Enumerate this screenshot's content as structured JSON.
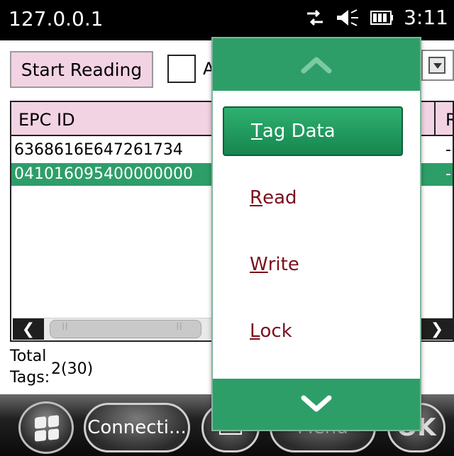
{
  "status_bar": {
    "title": "127.0.0.1",
    "time": "3:11",
    "icons": [
      "connectivity-icon",
      "speaker-icon",
      "battery-icon"
    ]
  },
  "toolbar": {
    "start_button": "Start Reading",
    "checkbox_label": "A"
  },
  "grid": {
    "columns": [
      "EPC ID",
      "R"
    ],
    "rows": [
      {
        "epc": "6368616E647261734",
        "r": "-"
      },
      {
        "epc": "041016095400000000",
        "r": "-"
      }
    ]
  },
  "totals": {
    "label_line1": "Total",
    "label_line2": "Tags:",
    "value": "2(30)"
  },
  "popup_menu": {
    "items": [
      {
        "access": "T",
        "rest": "ag Data",
        "selected": true
      },
      {
        "access": "R",
        "rest": "ead",
        "selected": false
      },
      {
        "access": "W",
        "rest": "rite",
        "selected": false
      },
      {
        "access": "L",
        "rest": "ock",
        "selected": false
      }
    ],
    "scroll_up_icon": "chevron-up-icon",
    "scroll_down_icon": "chevron-down-icon"
  },
  "softkeys": {
    "connect": "Connecti...",
    "menu": "Menu",
    "ok": "OK"
  },
  "colors": {
    "accent_green": "#2e9e69",
    "header_pink": "#f2d3e4",
    "menu_text": "#7a0f1c"
  }
}
